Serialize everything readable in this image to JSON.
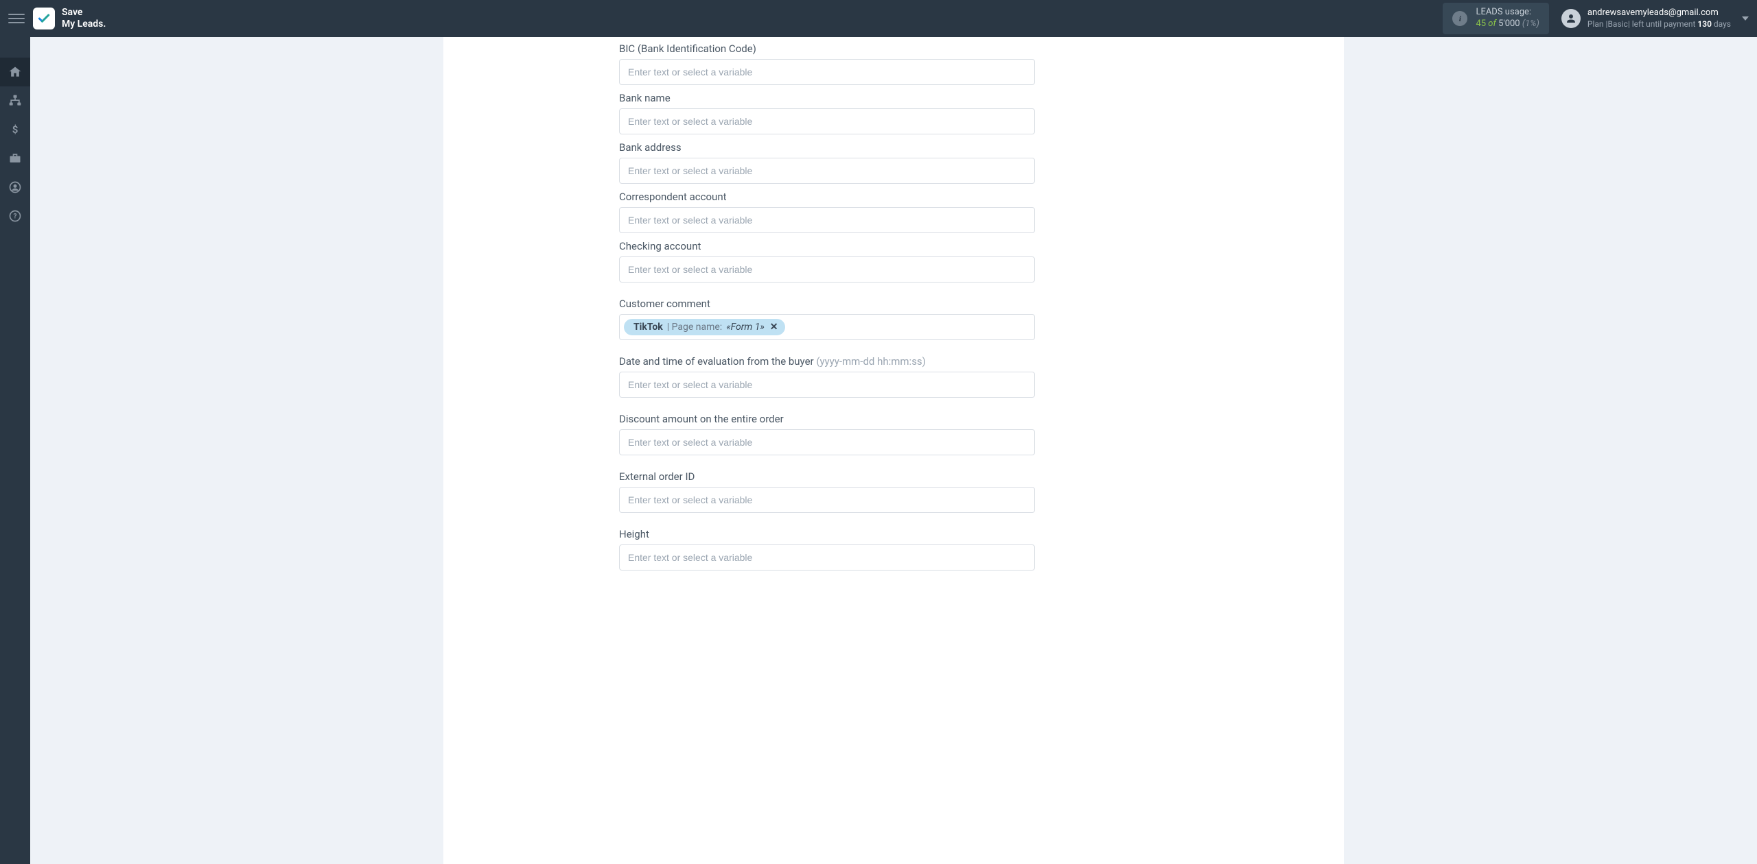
{
  "brand": {
    "line1": "Save",
    "line2": "My Leads."
  },
  "usage": {
    "label": "LEADS usage:",
    "count": "45",
    "of_word": "of",
    "total": "5'000",
    "pct": "(1%)"
  },
  "user": {
    "email": "andrewsavemyleads@gmail.com",
    "plan_prefix": "Plan |",
    "plan_name": "Basic",
    "plan_mid": "| left until payment ",
    "days_num": "130",
    "days_word": " days"
  },
  "form": {
    "placeholder": "Enter text or select a variable",
    "fields": {
      "bic": {
        "label": "BIC (Bank Identification Code)"
      },
      "bank_name": {
        "label": "Bank name"
      },
      "bank_address": {
        "label": "Bank address"
      },
      "corr_account": {
        "label": "Correspondent account"
      },
      "checking_account": {
        "label": "Checking account"
      },
      "customer_comment": {
        "label": "Customer comment",
        "tag": {
          "source": "TikTok",
          "separator": " | Page name: ",
          "value": "«Form 1»"
        }
      },
      "eval_date": {
        "label": "Date and time of evaluation from the buyer ",
        "hint": "(yyyy-mm-dd hh:mm:ss)"
      },
      "discount": {
        "label": "Discount amount on the entire order"
      },
      "external_id": {
        "label": "External order ID"
      },
      "height": {
        "label": "Height"
      }
    }
  }
}
